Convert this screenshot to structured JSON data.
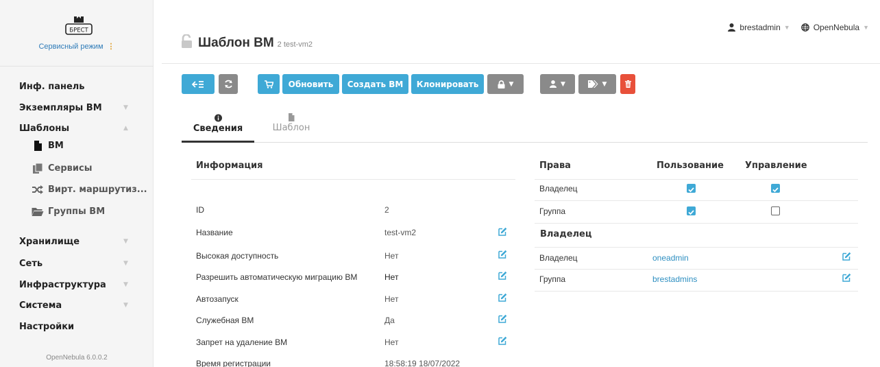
{
  "sidebar": {
    "logo_text": "БРЕСТ",
    "mode_label": "Сервисный режим",
    "items": [
      {
        "label": "Инф. панель"
      },
      {
        "label": "Экземпляры ВМ"
      },
      {
        "label": "Шаблоны"
      },
      {
        "label": "Хранилище"
      },
      {
        "label": "Сеть"
      },
      {
        "label": "Инфраструктура"
      },
      {
        "label": "Система"
      },
      {
        "label": "Настройки"
      }
    ],
    "subitems": [
      {
        "label": "ВМ",
        "icon": "file-icon"
      },
      {
        "label": "Сервисы",
        "icon": "files-icon"
      },
      {
        "label": "Вирт. маршрутиз...",
        "icon": "shuffle-icon"
      },
      {
        "label": "Группы ВМ",
        "icon": "folder-icon"
      }
    ],
    "version": "OpenNebula 6.0.0.2"
  },
  "header": {
    "title": "Шаблон ВМ",
    "subtitle": "2 test-vm2",
    "user": "brestadmin",
    "zone": "OpenNebula"
  },
  "toolbar": {
    "update_label": "Обновить",
    "create_vm_label": "Создать ВМ",
    "clone_label": "Клонировать"
  },
  "tabs": [
    {
      "label": "Сведения",
      "icon": "info-icon"
    },
    {
      "label": "Шаблон",
      "icon": "file-icon"
    }
  ],
  "info": {
    "title": "Информация",
    "rows": [
      {
        "label": "ID",
        "value": "2"
      },
      {
        "label": "Название",
        "value": "test-vm2"
      },
      {
        "label": "Высокая доступность",
        "value": "Нет"
      },
      {
        "label": "Разрешить автоматическую миграцию ВМ",
        "value": "Нет"
      },
      {
        "label": "Автозапуск",
        "value": "Нет"
      },
      {
        "label": "Служебная ВМ",
        "value": "Да"
      },
      {
        "label": "Запрет на удаление ВМ",
        "value": "Нет"
      },
      {
        "label": "Время регистрации",
        "value": "18:58:19 18/07/2022"
      }
    ]
  },
  "permissions": {
    "col_rights": "Права",
    "col_use": "Пользование",
    "col_manage": "Управление",
    "rows": [
      {
        "label": "Владелец",
        "use": true,
        "manage": true
      },
      {
        "label": "Группа",
        "use": true,
        "manage": false
      }
    ]
  },
  "ownership": {
    "title": "Владелец",
    "rows": [
      {
        "label": "Владелец",
        "value": "oneadmin"
      },
      {
        "label": "Группа",
        "value": "brestadmins"
      }
    ]
  },
  "colors": {
    "primary": "#3fa9d6",
    "gray_button": "#8a8a8a",
    "danger": "#e8503a",
    "link": "#2e8fc1"
  }
}
